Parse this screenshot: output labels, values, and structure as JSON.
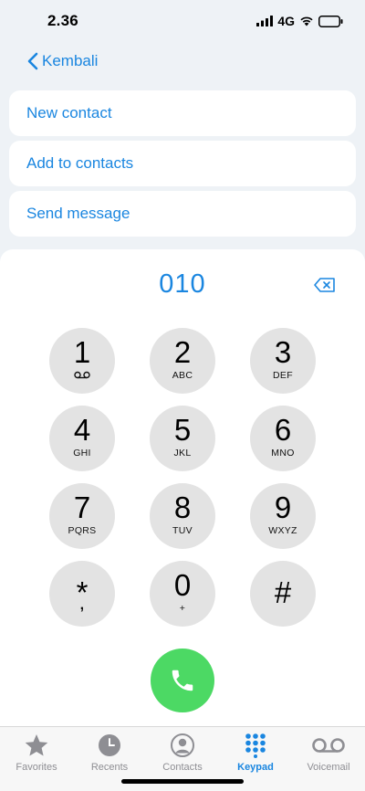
{
  "status": {
    "time": "2.36",
    "network": "4G"
  },
  "nav": {
    "back_label": "Kembali"
  },
  "menu": {
    "new_contact": "New contact",
    "add_to_contacts": "Add to contacts",
    "send_message": "Send message"
  },
  "dial": {
    "number": "010"
  },
  "keys": [
    {
      "digit": "1",
      "letters": ""
    },
    {
      "digit": "2",
      "letters": "ABC"
    },
    {
      "digit": "3",
      "letters": "DEF"
    },
    {
      "digit": "4",
      "letters": "GHI"
    },
    {
      "digit": "5",
      "letters": "JKL"
    },
    {
      "digit": "6",
      "letters": "MNO"
    },
    {
      "digit": "7",
      "letters": "PQRS"
    },
    {
      "digit": "8",
      "letters": "TUV"
    },
    {
      "digit": "9",
      "letters": "WXYZ"
    },
    {
      "digit": "*",
      "letters": ","
    },
    {
      "digit": "0",
      "letters": "+"
    },
    {
      "digit": "#",
      "letters": ""
    }
  ],
  "tabs": [
    {
      "label": "Favorites",
      "icon": "star-icon",
      "active": false
    },
    {
      "label": "Recents",
      "icon": "clock-icon",
      "active": false
    },
    {
      "label": "Contacts",
      "icon": "person-icon",
      "active": false
    },
    {
      "label": "Keypad",
      "icon": "keypad-icon",
      "active": true
    },
    {
      "label": "Voicemail",
      "icon": "voicemail-icon",
      "active": false
    }
  ],
  "colors": {
    "accent": "#1a86e0",
    "call": "#4cd964",
    "key": "#e3e3e3",
    "inactive": "#8e8e93"
  }
}
